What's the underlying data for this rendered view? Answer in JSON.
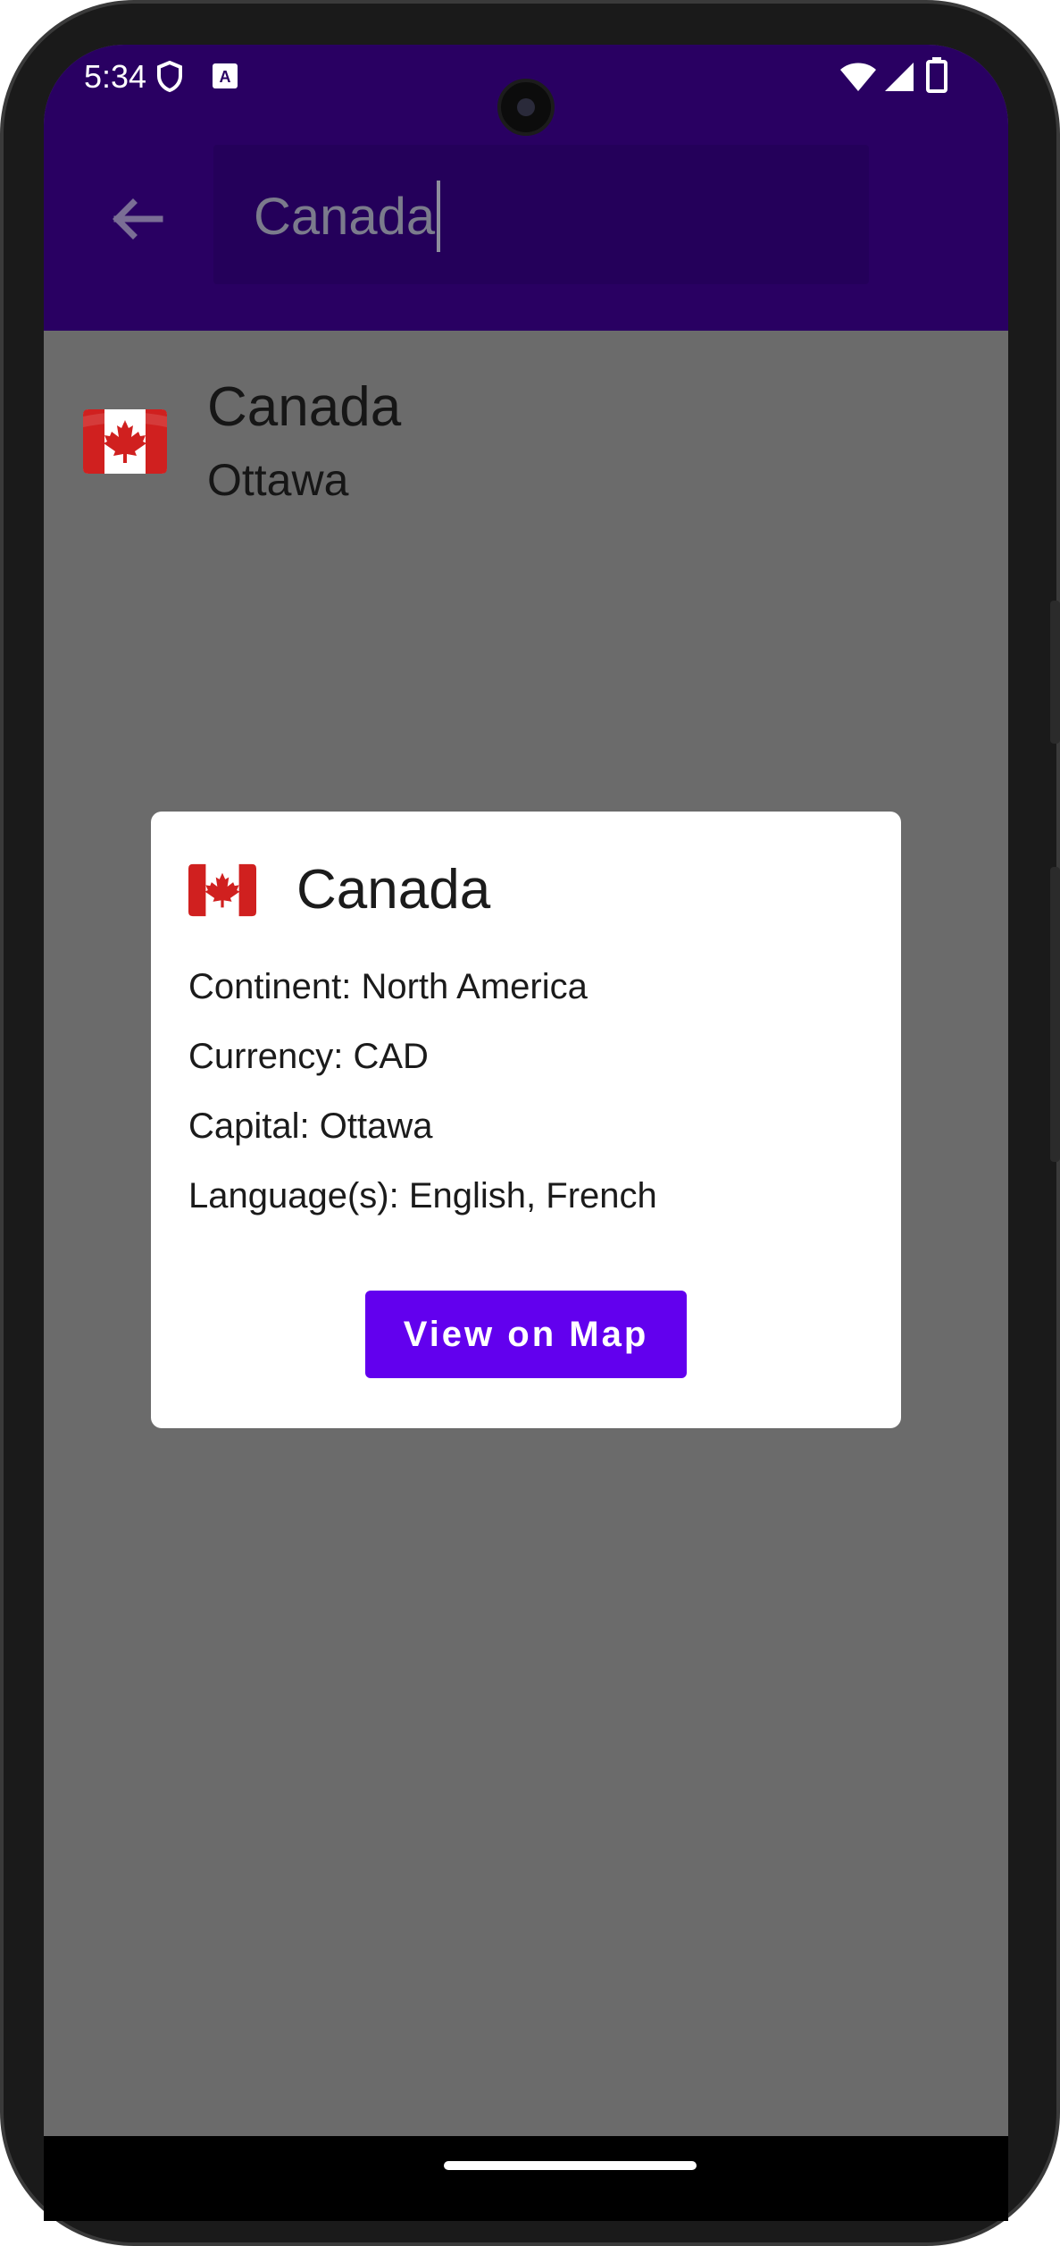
{
  "status_bar": {
    "time": "5:34",
    "icons": [
      "shield-icon",
      "keyboard-a-icon",
      "wifi-icon",
      "cellular-signal-icon",
      "battery-icon"
    ]
  },
  "app_bar": {
    "back_icon": "arrow-back-icon",
    "search": {
      "value": "Canada"
    }
  },
  "results": [
    {
      "flag": "canada-flag-icon",
      "name": "Canada",
      "capital": "Ottawa"
    }
  ],
  "dialog": {
    "flag": "canada-flag-icon",
    "title": "Canada",
    "continent": "Continent: North America",
    "currency": "Currency: CAD",
    "capital": "Capital: Ottawa",
    "languages": "Language(s): English, French",
    "button_label": "View on Map"
  },
  "colors": {
    "app_bar": "#290062",
    "scrim": "#6b6b6b",
    "button": "#6200ee"
  }
}
